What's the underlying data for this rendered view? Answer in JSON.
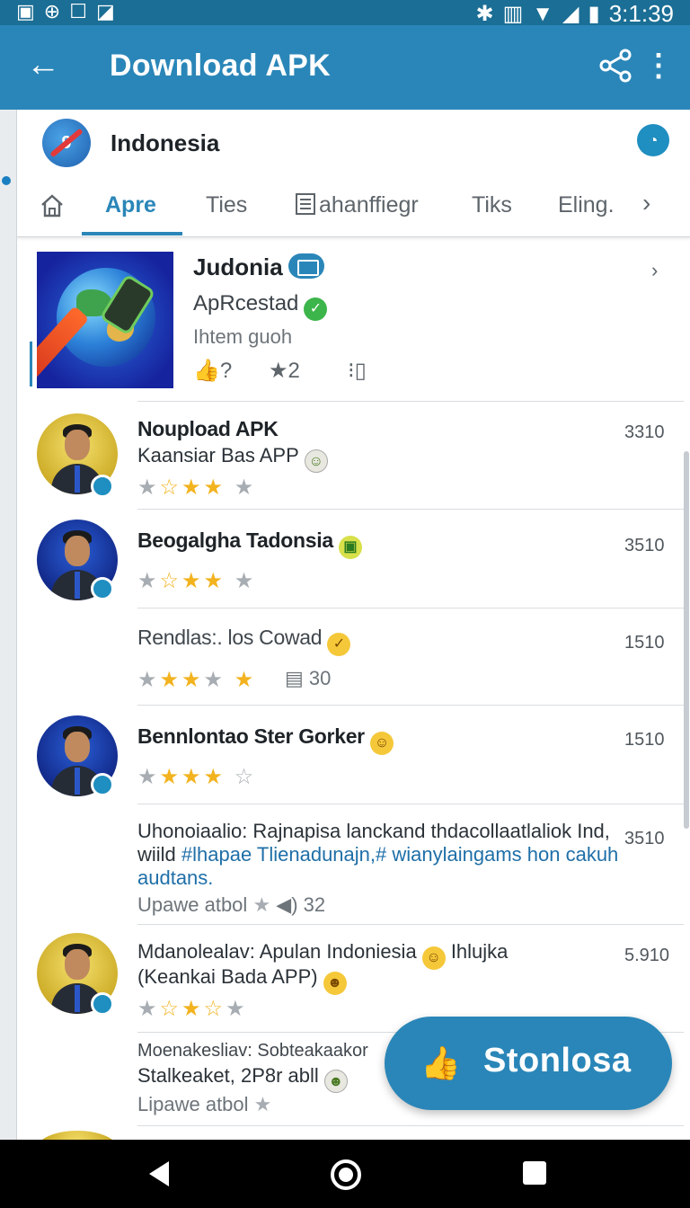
{
  "status_bar": {
    "time": "3:1:39",
    "left_icons": [
      "app-notification-icon",
      "location-icon",
      "square-icon",
      "tag-icon"
    ],
    "right_icons": [
      "bluetooth-icon",
      "vibrate-icon",
      "wifi-icon",
      "signal-icon",
      "battery-icon"
    ]
  },
  "app_bar": {
    "title": "Download APK",
    "back_icon": "arrow-left-icon",
    "share_icon": "share-icon",
    "more_icon": "more-vert-icon"
  },
  "section": {
    "title": "Indonesia",
    "logo_text": "9"
  },
  "tabs": {
    "items": [
      {
        "label": "Apre",
        "active": true
      },
      {
        "label": "Ties",
        "active": false
      },
      {
        "label": "ahanffiegr",
        "active": false
      },
      {
        "label": "Tiks",
        "active": false
      },
      {
        "label": "Eling.",
        "active": false
      }
    ]
  },
  "feature": {
    "title": "Judonia",
    "subtitle": "ApRcestad",
    "meta": "Ihtem guoh",
    "like_label": "?",
    "star_count": "2"
  },
  "list": {
    "items": [
      {
        "title": "Noupload APK",
        "subtitle": "Kaansiar Bas APP",
        "count": "3310",
        "rating": 3.5
      },
      {
        "title": "Beogalgha Tadonsia",
        "count": "3510",
        "rating": 3.5
      },
      {
        "title": "Rendlas:. los Cowad",
        "count": "1510",
        "rating": 3.5,
        "comments": "30"
      },
      {
        "title": "Bennlontao Ster Gorker",
        "count": "1510",
        "rating": 3.5
      },
      {
        "title": "Uhonoiaalio: Rajnapisa lanckand thdacollaatlaliok Ind,",
        "line2_prefix": "wiild ",
        "line2_link": "#lhapae Tlienadunajn,# wianylaingams hon cakuh",
        "line3": "audtans.",
        "meta": "Upawe atbol",
        "comments": "32",
        "count": "3510"
      },
      {
        "title": "Mdanolealav: Apulan Indoniesia",
        "title_suffix": "Ihlujka",
        "subtitle": "(Keankai Bada APP)",
        "count": "5.910",
        "rating": 3.5
      },
      {
        "title": "Moenakesliav: Sobteakaakor",
        "subtitle": "Stalkeaket, 2P8r abll",
        "meta": "Lipawe atbol"
      }
    ]
  },
  "fab": {
    "label": "Stonlosa",
    "icon": "thumbs-up-icon"
  },
  "colors": {
    "primary": "#2a86b8",
    "status_bar": "#1b6e95",
    "star": "#f2b31f"
  }
}
